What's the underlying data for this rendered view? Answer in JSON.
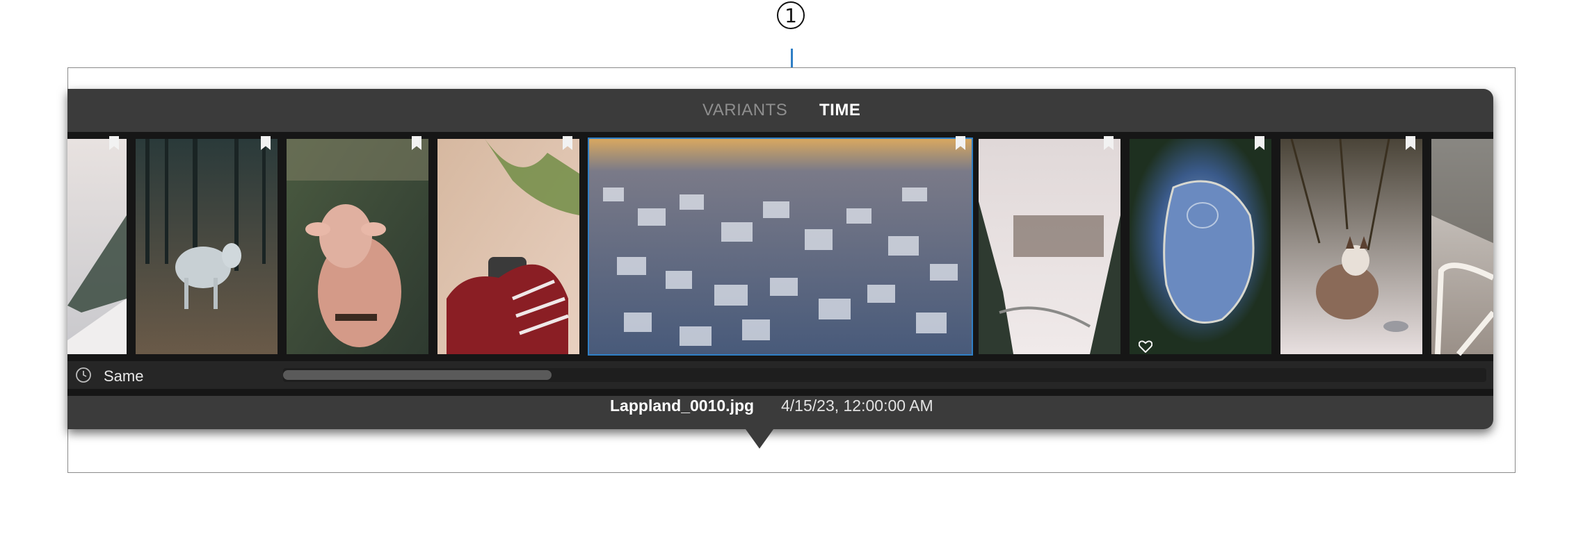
{
  "callout": {
    "number": "1"
  },
  "tabs": [
    {
      "label": "VARIANTS",
      "active": false
    },
    {
      "label": "TIME",
      "active": true
    }
  ],
  "thumbnails": [
    {
      "subject": "snowy forest road",
      "bookmarked": true
    },
    {
      "subject": "cow in dark forest",
      "bookmarked": true
    },
    {
      "subject": "cow close-up",
      "bookmarked": true
    },
    {
      "subject": "mittens holding mug",
      "bookmarked": true
    },
    {
      "subject": "aerial snowy town",
      "bookmarked": true,
      "selected": true
    },
    {
      "subject": "snowy park with trees",
      "bookmarked": true
    },
    {
      "subject": "aerial frozen lake",
      "bookmarked": true,
      "favorite": true
    },
    {
      "subject": "husky dog in snow",
      "bookmarked": true
    },
    {
      "subject": "snowy wooden stairs",
      "bookmarked": false
    }
  ],
  "infobar": {
    "group_label": "Same",
    "scroll_position": 0.2
  },
  "footer": {
    "filename": "Lappland_0010.jpg",
    "datetime": "4/15/23, 12:00:00 AM"
  },
  "colors": {
    "popover": "#3b3b3b",
    "accent": "#2f7fc6",
    "strip": "#161616"
  }
}
